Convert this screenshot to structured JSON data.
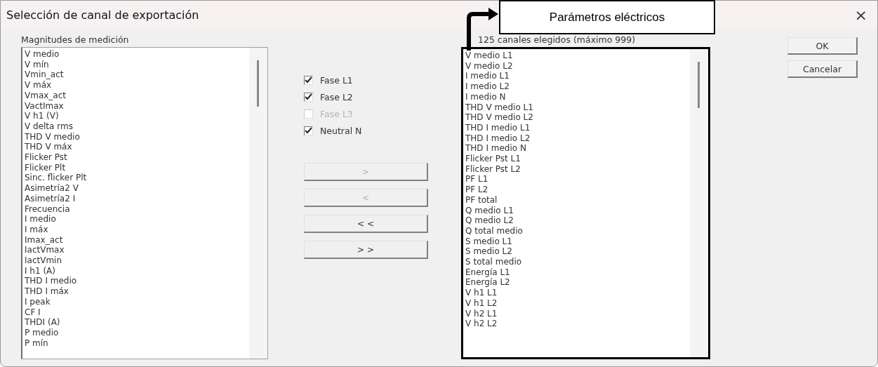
{
  "window": {
    "title": "Selección de canal de exportación",
    "close": "×"
  },
  "annotation": {
    "label": "Parámetros eléctricos"
  },
  "measurements": {
    "label": "Magnitudes de medición",
    "items": [
      "V medio",
      "V mín",
      "Vmin_act",
      "V máx",
      "Vmax_act",
      "VactImax",
      "V h1 (V)",
      "V delta rms",
      "THD V medio",
      "THD V máx",
      "Flicker Pst",
      "Flicker Plt",
      "Sinc. flicker Plt",
      "Asimetría2 V",
      "Asimetría2 I",
      "Frecuencia",
      "I medio",
      "I máx",
      "Imax_act",
      "IactVmax",
      "IactVmin",
      "I h1 (A)",
      "THD I medio",
      "THD I máx",
      "I peak",
      "CF I",
      "THDI (A)",
      "P medio",
      "P mín"
    ]
  },
  "phases": [
    {
      "label": "Fase L1",
      "checked": true,
      "disabled": false
    },
    {
      "label": "Fase L2",
      "checked": true,
      "disabled": false
    },
    {
      "label": "Fase L3",
      "checked": false,
      "disabled": true
    },
    {
      "label": "Neutral N",
      "checked": true,
      "disabled": false
    }
  ],
  "move_buttons": [
    {
      "label": ">",
      "disabled": true
    },
    {
      "label": "<",
      "disabled": true
    },
    {
      "label": "< <",
      "disabled": false
    },
    {
      "label": "> >",
      "disabled": false
    }
  ],
  "selected_channels": {
    "label": "125 canales elegidos (máximo 999)",
    "items": [
      "V medio L1",
      "V medio L2",
      "I medio L1",
      "I medio L2",
      "I medio N",
      "THD V medio L1",
      "THD V medio L2",
      "THD I medio L1",
      "THD I medio L2",
      "THD I medio N",
      "Flicker Pst L1",
      "Flicker Pst L2",
      "PF L1",
      "PF L2",
      "PF total",
      "Q medio L1",
      "Q medio L2",
      "Q total medio",
      "S medio L1",
      "S medio L2",
      "S total medio",
      "Energía L1",
      "Energía L2",
      "V h1 L1",
      "V h1 L2",
      "V h2 L1",
      "V h2 L2"
    ]
  },
  "buttons": [
    "OK",
    "Cancelar"
  ]
}
